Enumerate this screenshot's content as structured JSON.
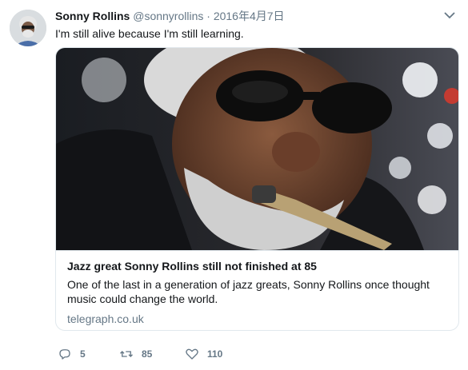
{
  "tweet": {
    "author_name": "Sonny Rollins",
    "author_handle": "@sonnyrollins",
    "separator": "·",
    "date": "2016年4月7日",
    "text": "I'm still alive because I'm still learning."
  },
  "card": {
    "title": "Jazz great Sonny Rollins still not finished at 85",
    "description_line1": "One of the last in a generation of jazz greats, Sonny Rollins once thought",
    "description_line2": "music could change the world.",
    "domain": "telegraph.co.uk"
  },
  "actions": {
    "reply_count": "5",
    "retweet_count": "85",
    "like_count": "110"
  },
  "icons": {
    "more": "chevron-down-icon",
    "reply": "reply-icon",
    "retweet": "retweet-icon",
    "like": "heart-icon"
  },
  "colors": {
    "primary_text": "#14171a",
    "secondary_text": "#657786",
    "border": "#e1e8ed"
  }
}
